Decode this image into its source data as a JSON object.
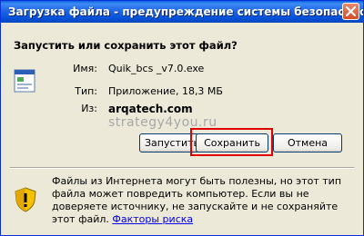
{
  "dialog": {
    "title": "Загрузка файла - предупреждение системы безопасности",
    "question": "Запустить или сохранить этот файл?"
  },
  "file": {
    "name_label": "Имя:",
    "name_value": "Quik_bcs _v7.0.exe",
    "type_label": "Тип:",
    "type_value": "Приложение, 18,3 МБ",
    "from_label": "Из:",
    "from_value": "arqatech.com"
  },
  "watermark": "strategy4you.ru",
  "buttons": {
    "run": "Запустить",
    "save": "Сохранить",
    "cancel": "Отмена"
  },
  "warning": {
    "text": "Файлы из Интернета могут быть полезны, но этот тип файла может повредить компьютер. Если вы не доверяете источнику, не запускайте и не сохраняйте этот файл. ",
    "link": "Факторы риска"
  },
  "colors": {
    "titlebar": "#0a5fe0",
    "highlight": "#e00000",
    "link": "#0000ee"
  },
  "icons": {
    "close": "close-icon",
    "file": "application-file-icon",
    "warning": "security-shield-icon"
  }
}
